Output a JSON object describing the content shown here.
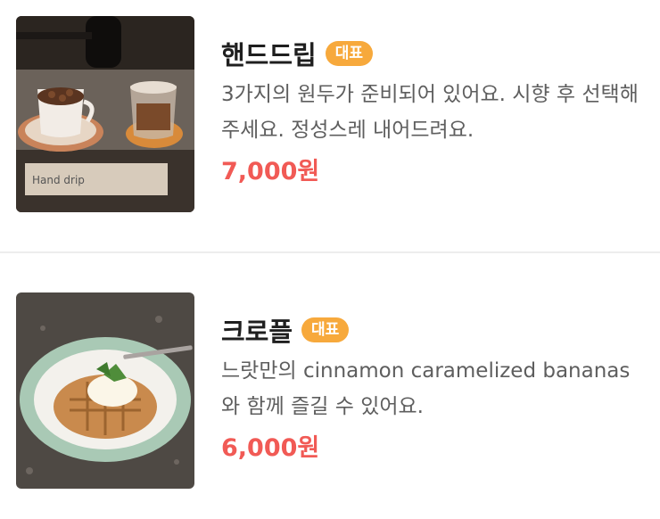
{
  "items": [
    {
      "name": "핸드드립",
      "badge": "대표",
      "description": "3가지의 원두가 준비되어 있어요. 시향 후 선택해 주세요. 정성스레 내어드려요.",
      "price": "7,000원",
      "image_text": "Hand drip"
    },
    {
      "name": "크로플",
      "badge": "대표",
      "description": "느랏만의 cinnamon caramelized bananas와 함께 즐길 수 있어요.",
      "price": "6,000원"
    }
  ],
  "colors": {
    "badge": "#f7a93c",
    "price": "#f15a55"
  }
}
